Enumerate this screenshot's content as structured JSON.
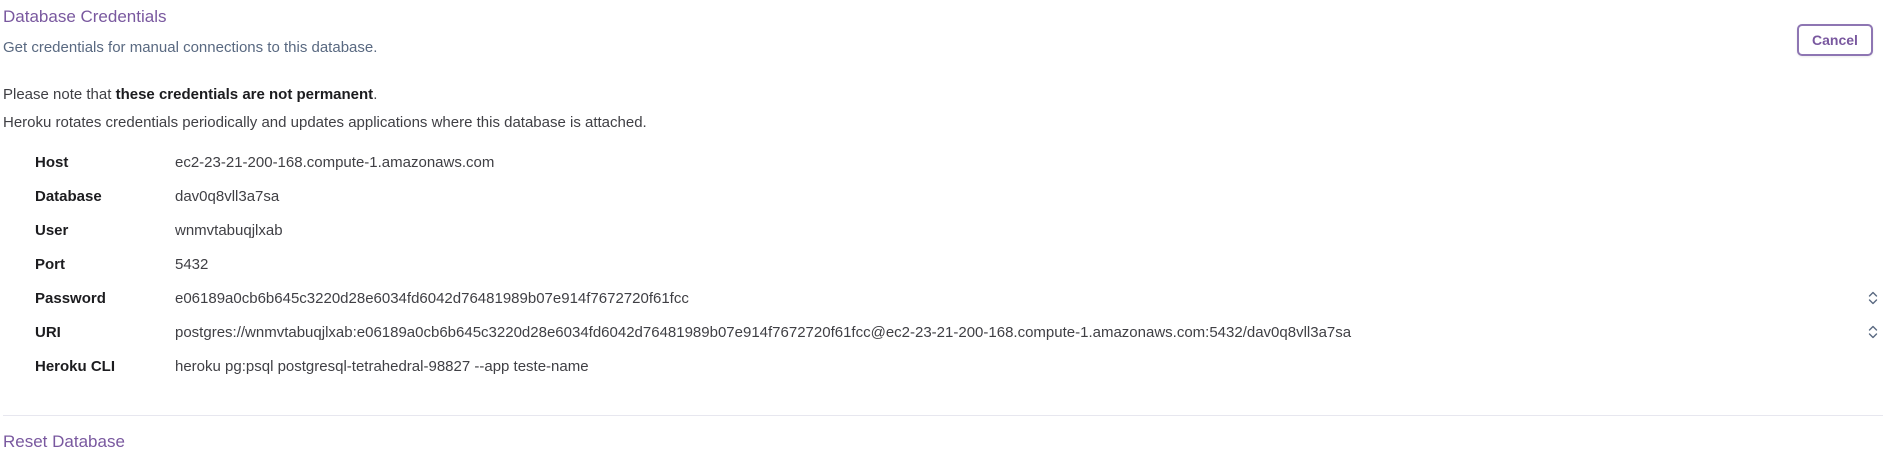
{
  "header": {
    "title": "Database Credentials",
    "subtitle": "Get credentials for manual connections to this database.",
    "cancel_label": "Cancel"
  },
  "notice": {
    "prefix": "Please note that ",
    "emphasis": "these credentials are not permanent",
    "suffix": ".",
    "detail": "Heroku rotates credentials periodically and updates applications where this database is attached."
  },
  "credentials": [
    {
      "label": "Host",
      "value": "ec2-23-21-200-168.compute-1.amazonaws.com"
    },
    {
      "label": "Database",
      "value": "dav0q8vll3a7sa"
    },
    {
      "label": "User",
      "value": "wnmvtabuqjlxab"
    },
    {
      "label": "Port",
      "value": "5432"
    },
    {
      "label": "Password",
      "value": "e06189a0cb6b645c3220d28e6034fd6042d76481989b07e914f7672720f61fcc"
    },
    {
      "label": "URI",
      "value": "postgres://wnmvtabuqjlxab:e06189a0cb6b645c3220d28e6034fd6042d76481989b07e914f7672720f61fcc@ec2-23-21-200-168.compute-1.amazonaws.com:5432/dav0q8vll3a7sa"
    },
    {
      "label": "Heroku CLI",
      "value": "heroku pg:psql postgresql-tetrahedral-98827 --app teste-name"
    }
  ],
  "next_section": {
    "title": "Reset Database"
  },
  "icons": {
    "reveal_toggle": "chevron-up-down-icon"
  },
  "colors": {
    "accent": "#79589f",
    "subtitle": "#596981",
    "text": "#3f3f44",
    "label": "#1c1c1f"
  }
}
